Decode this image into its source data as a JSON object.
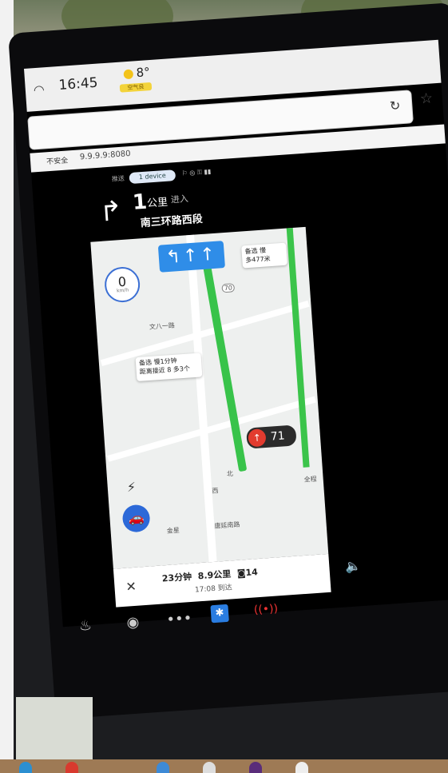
{
  "status": {
    "time": "16:45",
    "temperature": "8°",
    "weather_badge": "空气良"
  },
  "browser": {
    "security_label": "不安全",
    "address": "9.9.9.9:8080"
  },
  "device": {
    "prefix": "推送",
    "pill": "1 device"
  },
  "navigation": {
    "turn_distance_number": "1",
    "turn_distance_unit": "公里",
    "action": "进入",
    "road_name": "南三环路西段",
    "speed": "0",
    "speed_unit": "km/h",
    "callout_left_line1": "备选 慢1分钟",
    "callout_left_line2": "距离接近 8 多3个",
    "callout_right_line1": "备选 慢",
    "callout_right_line2": "多477米",
    "light_countdown": "71",
    "poi_1": "文八一路",
    "poi_2": "北",
    "poi_3": "西",
    "poi_4": "金星",
    "poi_5": "唐延南路",
    "poi_6": "全程",
    "road_tag_70": "70"
  },
  "eta": {
    "duration": "23分钟",
    "distance": "8.9公里",
    "lights": "14",
    "arrival": "17:08 到达"
  }
}
